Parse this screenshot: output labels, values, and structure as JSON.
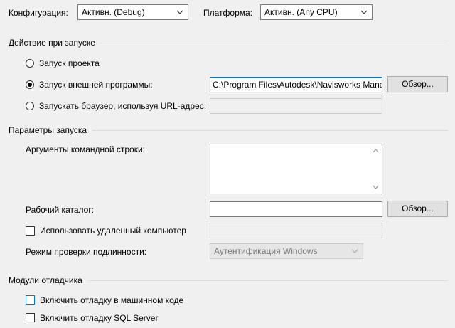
{
  "header": {
    "config_label": "Конфигурация:",
    "config_value": "Активн. (Debug)",
    "platform_label": "Платформа:",
    "platform_value": "Активн. (Any CPU)"
  },
  "start_action": {
    "title": "Действие при запуске",
    "option_project": "Запуск проекта",
    "option_external": "Запуск внешней программы:",
    "option_browser": "Запускать браузер, используя URL-адрес:",
    "external_path": "C:\\Program Files\\Autodesk\\Navisworks Mana",
    "browse_label": "Обзор...",
    "selected": "external"
  },
  "start_options": {
    "title": "Параметры запуска",
    "args_label": "Аргументы командной строки:",
    "workdir_label": "Рабочий каталог:",
    "workdir_value": "",
    "browse_label": "Обзор...",
    "remote_label": "Использовать удаленный компьютер",
    "auth_label": "Режим проверки подлинности:",
    "auth_value": "Аутентификация Windows"
  },
  "debuggers": {
    "title": "Модули отладчика",
    "native_label": "Включить отладку в машинном коде",
    "sql_label": "Включить отладку SQL Server"
  },
  "colors": {
    "background": "#f0f0f0",
    "focus_border": "#0078d7"
  }
}
